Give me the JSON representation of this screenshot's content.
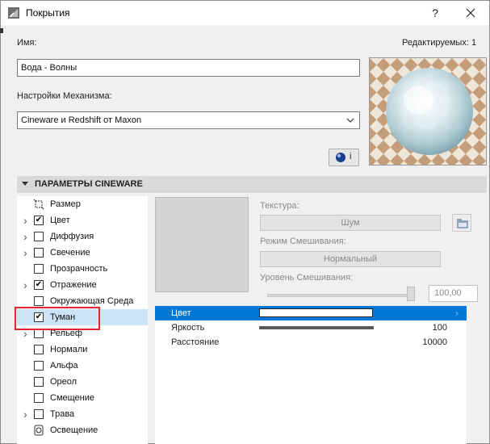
{
  "window": {
    "title": "Покрытия"
  },
  "header": {
    "name_label": "Имя:",
    "editable_label": "Редактируемых: 1"
  },
  "name_field": {
    "value": "Вода - Волны"
  },
  "engine": {
    "label": "Настройки Механизма:",
    "value": "Cineware и Redshift от Maxon"
  },
  "info_button": {
    "label": "i"
  },
  "section": {
    "title": "ПАРАМЕТРЫ CINEWARE"
  },
  "channels": [
    {
      "label": "Размер",
      "has_chevron": false,
      "kind": "icon",
      "checked": false
    },
    {
      "label": "Цвет",
      "has_chevron": true,
      "kind": "checkbox",
      "checked": true
    },
    {
      "label": "Диффузия",
      "has_chevron": true,
      "kind": "checkbox",
      "checked": false
    },
    {
      "label": "Свечение",
      "has_chevron": true,
      "kind": "checkbox",
      "checked": false
    },
    {
      "label": "Прозрачность",
      "has_chevron": false,
      "kind": "checkbox",
      "checked": false
    },
    {
      "label": "Отражение",
      "has_chevron": true,
      "kind": "checkbox",
      "checked": true
    },
    {
      "label": "Окружающая Среда",
      "has_chevron": false,
      "kind": "checkbox",
      "checked": false
    },
    {
      "label": "Туман",
      "has_chevron": false,
      "kind": "checkbox",
      "checked": true,
      "selected": true
    },
    {
      "label": "Рельеф",
      "has_chevron": true,
      "kind": "checkbox",
      "checked": false
    },
    {
      "label": "Нормали",
      "has_chevron": false,
      "kind": "checkbox",
      "checked": false
    },
    {
      "label": "Альфа",
      "has_chevron": false,
      "kind": "checkbox",
      "checked": false
    },
    {
      "label": "Ореол",
      "has_chevron": false,
      "kind": "checkbox",
      "checked": false
    },
    {
      "label": "Смещение",
      "has_chevron": false,
      "kind": "checkbox",
      "checked": false
    },
    {
      "label": "Трава",
      "has_chevron": true,
      "kind": "checkbox",
      "checked": false
    },
    {
      "label": "Освещение",
      "has_chevron": false,
      "kind": "icon",
      "checked": false
    }
  ],
  "texture": {
    "label": "Текстура:",
    "button": "Шум",
    "blend_mode_label": "Режим Смешивания:",
    "blend_mode_value": "Нормальный",
    "blend_level_label": "Уровень Смешивания:",
    "blend_level_value": "100,00",
    "blend_level_fraction": 1.0
  },
  "parameters": [
    {
      "name": "Цвет",
      "value": "",
      "kind": "color",
      "selected": true
    },
    {
      "name": "Яркость",
      "value": "100",
      "kind": "bar",
      "level": 1.0
    },
    {
      "name": "Расстояние",
      "value": "10000",
      "kind": "text"
    }
  ],
  "colors": {
    "selection": "#0078d7",
    "list_selection": "#cce4f7",
    "highlight": "#e3262b",
    "section_bg": "#d9d9d9"
  },
  "icons": {
    "app": "materials-icon",
    "close": "close-icon",
    "help": "help-icon",
    "size": "size-icon",
    "lighting": "lighting-icon",
    "folder": "folder-icon",
    "cinema": "cinema4d-icon"
  }
}
